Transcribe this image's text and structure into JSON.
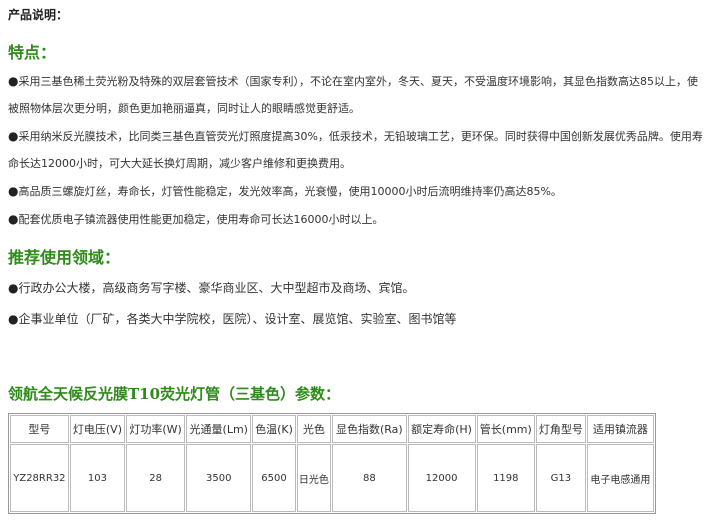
{
  "title": "产品说明：",
  "features": {
    "heading": "特点：",
    "bullet": "●",
    "items": [
      "采用三基色稀土荧光粉及特殊的双层套管技术（国家专利），不论在室内室外，冬天、夏天，不受温度环境影响，其显色指数高达85以上，使被照物体层次更分明，颜色更加艳丽逼真，同时让人的眼睛感觉更舒适。",
      "采用纳米反光膜技术，比同类三基色直管荧光灯照度提高30%，低汞技术，无铅玻璃工艺，更环保。同时获得中国创新发展优秀品牌。使用寿命长达12000小时，可大大延长换灯周期，减少客户维修和更换费用。",
      "高品质三螺旋灯丝，寿命长，灯管性能稳定，发光效率高，光衰慢，使用10000小时后流明维持率仍高达85%。",
      "配套优质电子镇流器使用性能更加稳定，使用寿命可长达16000小时以上。"
    ]
  },
  "usage": {
    "heading": "推荐使用领域：",
    "items": [
      "行政办公大楼，高级商务写字楼、豪华商业区、大中型超市及商场、宾馆。",
      "企事业单位（厂矿，各类大中学院校，医院）、设计室、展览馆、实验室、图书馆等"
    ]
  },
  "spec": {
    "heading": "领航全天候反光膜T10荧光灯管（三基色）参数：",
    "headers": [
      "型号",
      "灯电压(V)",
      "灯功率(W)",
      "光通量(Lm)",
      "色温(K)",
      "光色",
      "显色指数(Ra)",
      "额定寿命(H)",
      "管长(mm)",
      "灯角型号",
      "适用镇流器"
    ],
    "row": [
      "YZ28RR32",
      "103",
      "28",
      "3500",
      "6500",
      "日光色",
      "88",
      "12000",
      "1198",
      "G13",
      "电子电感通用"
    ]
  }
}
